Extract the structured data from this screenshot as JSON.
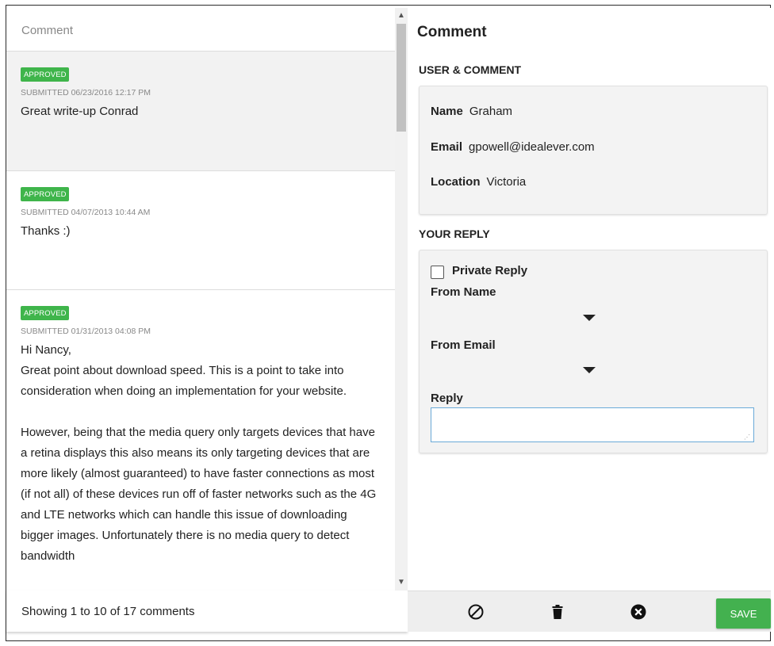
{
  "list": {
    "header": "Comment",
    "comments": [
      {
        "status": "APPROVED",
        "submitted": "SUBMITTED 06/23/2016 12:17 PM",
        "paragraphs": [
          "Great write-up Conrad"
        ]
      },
      {
        "status": "APPROVED",
        "submitted": "SUBMITTED 04/07/2013 10:44 AM",
        "paragraphs": [
          "Thanks :)"
        ]
      },
      {
        "status": "APPROVED",
        "submitted": "SUBMITTED 01/31/2013 04:08 PM",
        "paragraphs": [
          "Hi Nancy,",
          "Great point about download speed. This is a point to take into consideration when doing an implementation for your website.",
          "",
          "However, being that the media query only targets devices that have a retina displays this also means its only targeting devices that are more likely (almost guaranteed) to have faster connections as most (if not all) of these devices run off of faster networks such as the 4G and LTE networks which can handle this issue of downloading bigger images. Unfortunately there is no media query to detect bandwidth"
        ]
      }
    ],
    "footer": "Showing 1 to 10 of 17 comments"
  },
  "detail": {
    "title": "Comment",
    "user_section": {
      "label": "USER & COMMENT",
      "name_label": "Name",
      "name": "Graham",
      "email_label": "Email",
      "email": "gpowell@idealever.com",
      "location_label": "Location",
      "location": "Victoria"
    },
    "reply_section": {
      "label": "YOUR REPLY",
      "private_label": "Private Reply",
      "private_checked": false,
      "from_name_label": "From Name",
      "from_email_label": "From Email",
      "reply_label": "Reply",
      "reply_value": ""
    }
  },
  "actions": {
    "save_label": "SAVE",
    "icons": [
      "block-icon",
      "trash-icon",
      "close-circle-icon"
    ]
  },
  "colors": {
    "approved": "#3fb54b",
    "save": "#43b14f",
    "reply_border": "#6aaad8"
  }
}
